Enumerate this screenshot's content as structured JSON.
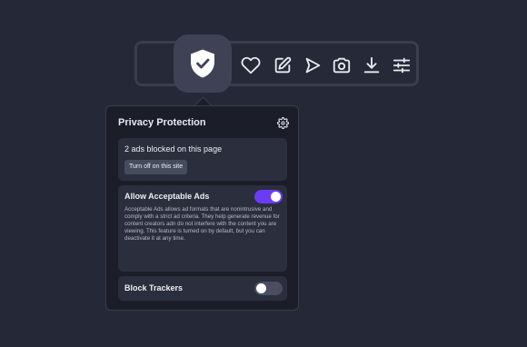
{
  "toolbar": {
    "icons": [
      "shield-check-icon",
      "heart-icon",
      "edit-icon",
      "send-icon",
      "camera-icon",
      "download-icon",
      "sliders-icon"
    ]
  },
  "popover": {
    "title": "Privacy Protection",
    "settings_icon": "gear-icon",
    "blocked": {
      "text": "2 ads blocked on this page",
      "button_label": "Turn off on this site"
    },
    "acceptable_ads": {
      "label": "Allow Acceptable Ads",
      "enabled": true,
      "description": "Acceptable Ads allows ad formats that are nonintrusive and comply with a strict ad criteria. They help generate revenue for content creators adn do not interfere with the content you are viewing. This feature is turned on by default, but you can deactivate it at any time."
    },
    "block_trackers": {
      "label": "Block Trackers",
      "enabled": false
    }
  },
  "colors": {
    "background": "#252836",
    "accent": "#6a3cf5",
    "card": "#2b2e3d",
    "popover": "#1b1d28"
  }
}
